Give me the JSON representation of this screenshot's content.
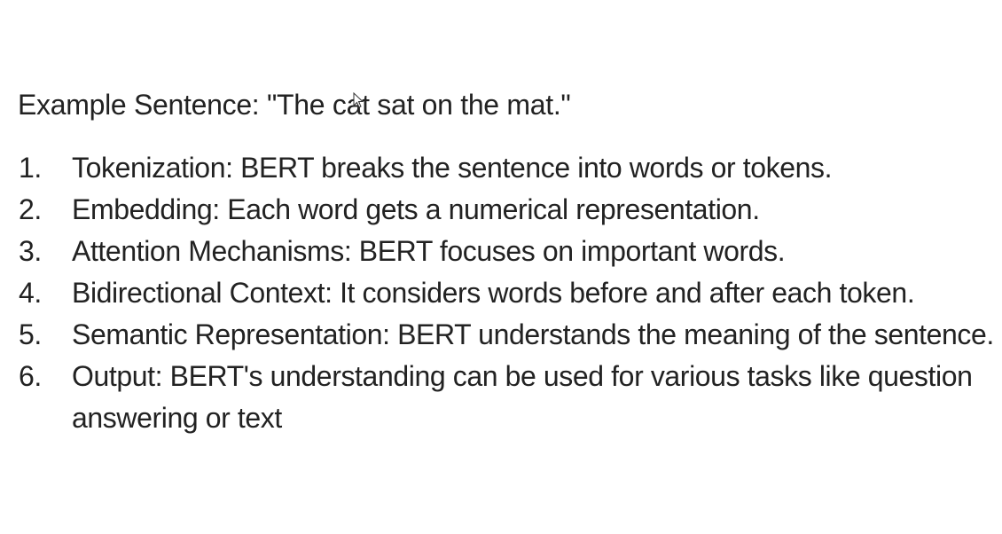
{
  "example": {
    "label": "Example Sentence: \"The cat sat on the mat.\""
  },
  "steps": [
    {
      "number": "1.",
      "text": "Tokenization: BERT breaks the sentence into words or tokens."
    },
    {
      "number": "2.",
      "text": "Embedding: Each word gets a numerical representation."
    },
    {
      "number": "3.",
      "text": "Attention Mechanisms: BERT focuses on important words."
    },
    {
      "number": "4.",
      "text": "Bidirectional Context: It considers words before and after each token."
    },
    {
      "number": "5.",
      "text": "Semantic Representation: BERT understands the meaning of the sentence."
    },
    {
      "number": "6.",
      "text": "Output: BERT's understanding can be used for various tasks like question answering or text"
    }
  ],
  "icons": {
    "cursor": "mouse-pointer-icon"
  }
}
